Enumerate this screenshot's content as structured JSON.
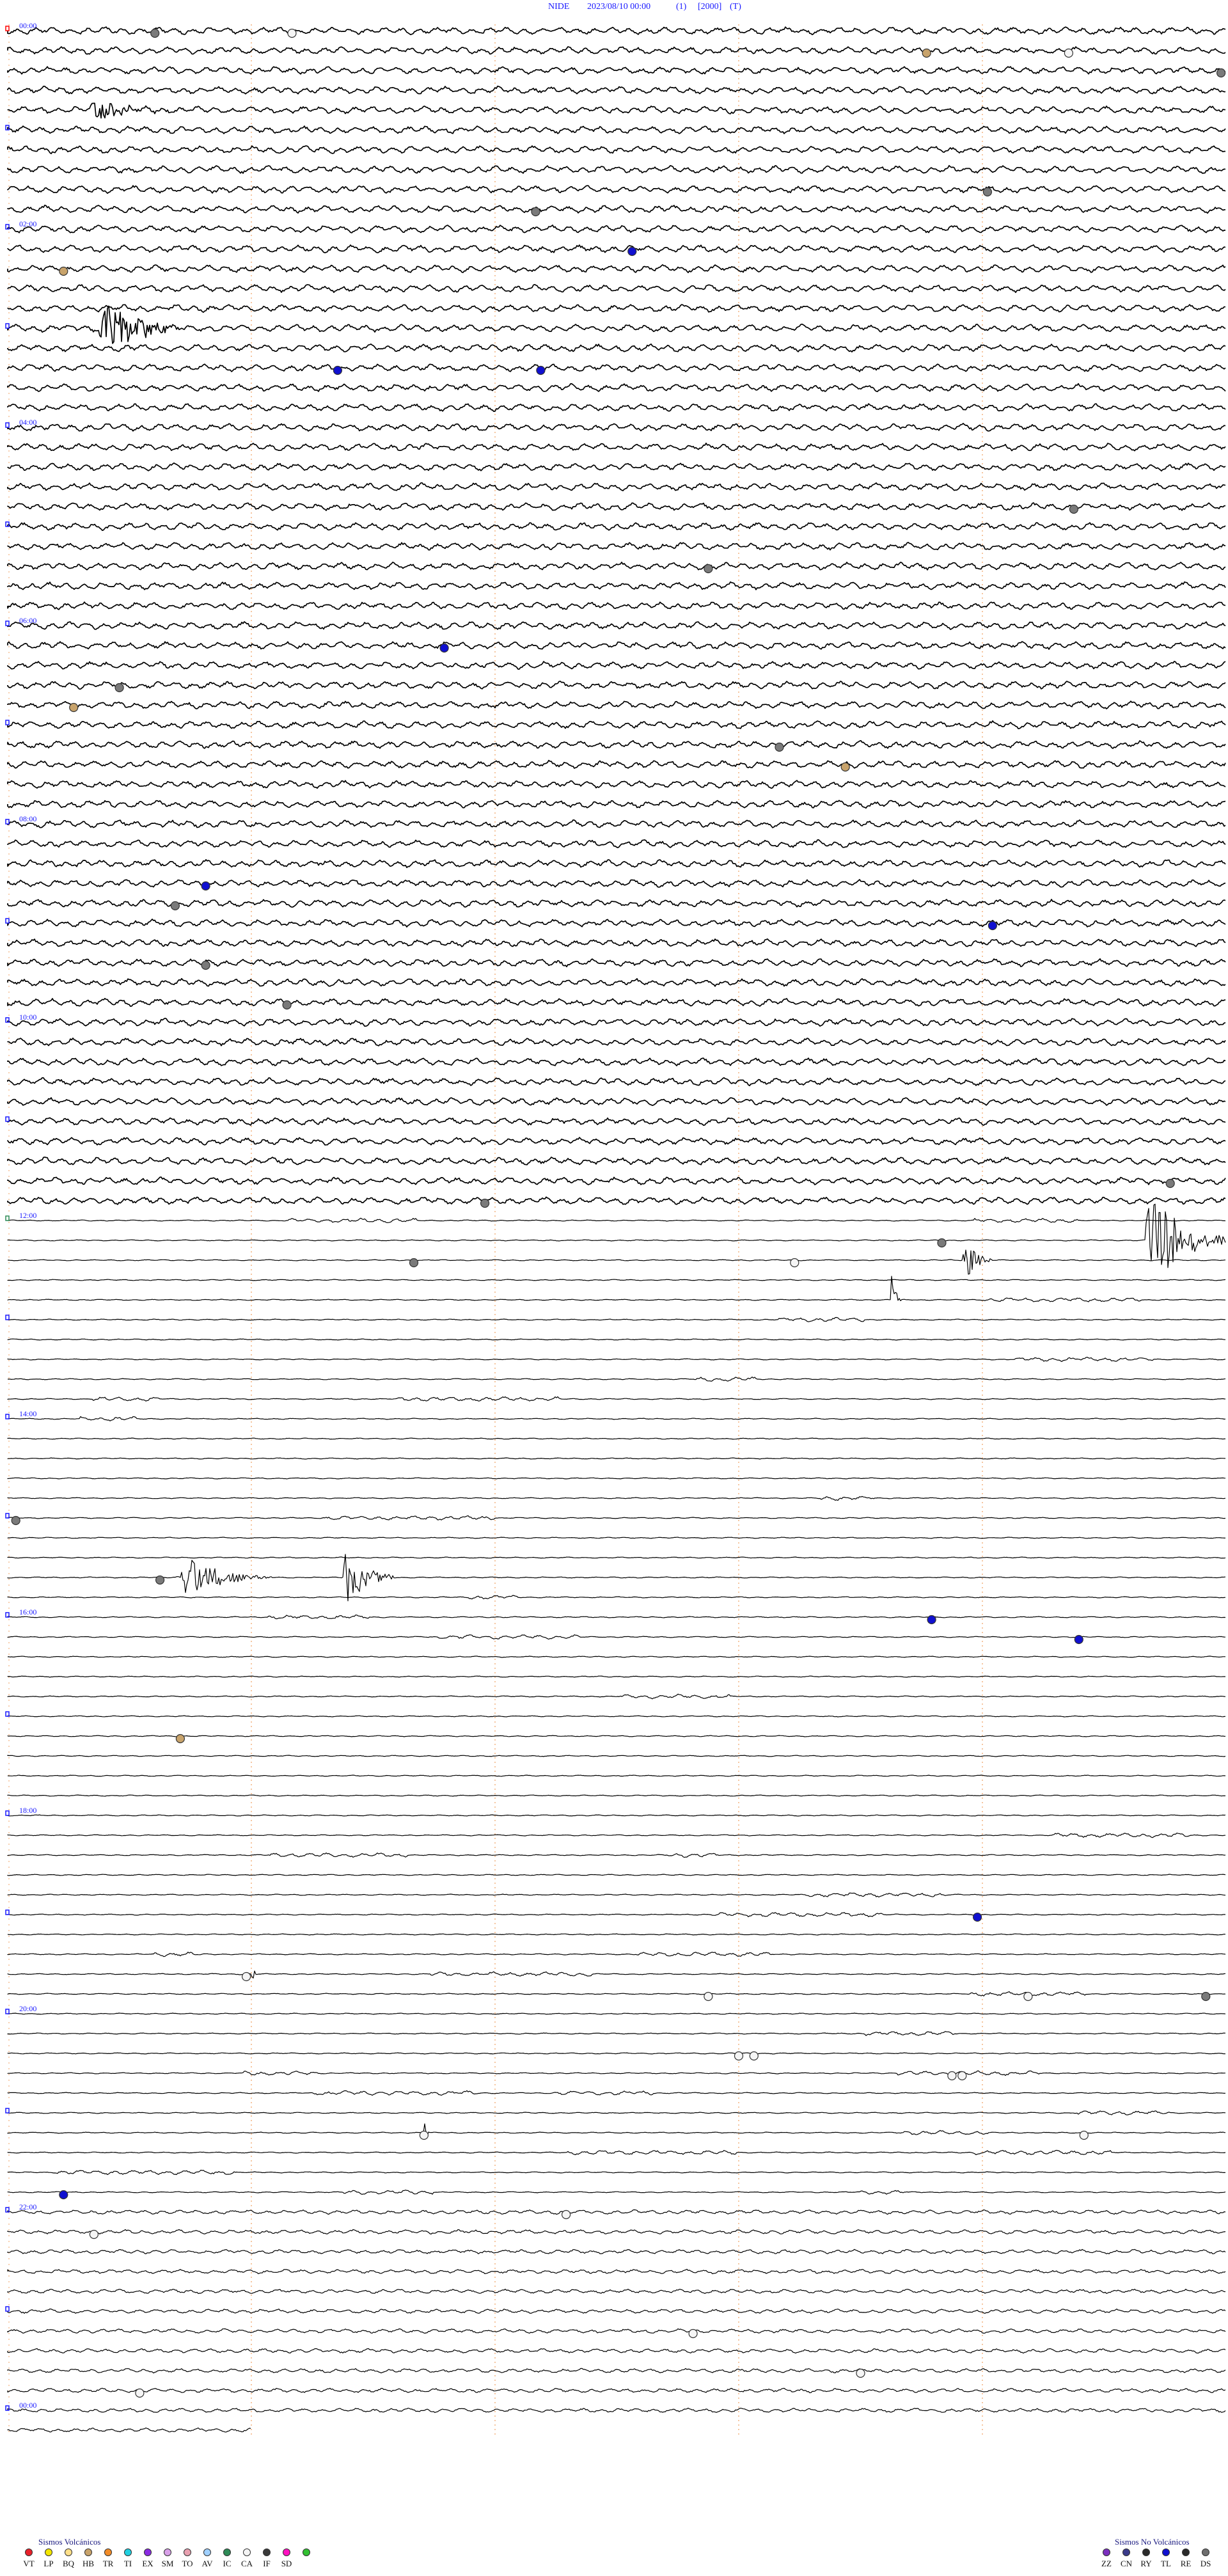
{
  "header": {
    "station": "NIDE",
    "datetime": "2023/08/10 00:00",
    "channel": "(1)",
    "scale": "[2000]",
    "mode": "(T)"
  },
  "chart_data": {
    "type": "line",
    "title": "NIDE 2023/08/10 00:00 (1) [2000] (T)",
    "xlabel": "",
    "ylabel": "",
    "row_count": 122,
    "minutes_per_row": 12,
    "hour_labels": [
      {
        "row": 0,
        "text": "00:00"
      },
      {
        "row": 10,
        "text": "02:00"
      },
      {
        "row": 20,
        "text": "04:00"
      },
      {
        "row": 30,
        "text": "06:00"
      },
      {
        "row": 40,
        "text": "08:00"
      },
      {
        "row": 50,
        "text": "10:00"
      },
      {
        "row": 60,
        "text": "12:00"
      },
      {
        "row": 70,
        "text": "14:00"
      },
      {
        "row": 80,
        "text": "16:00"
      },
      {
        "row": 90,
        "text": "18:00"
      },
      {
        "row": 100,
        "text": "20:00"
      },
      {
        "row": 110,
        "text": "22:00"
      },
      {
        "row": 120,
        "text": "00:00"
      }
    ],
    "minute_gridlines": [
      2.4,
      4.8,
      7.2,
      9.6
    ],
    "segments": [
      {
        "name": "00:00-12:00",
        "from_row": 0,
        "to_row": 60,
        "noise": "high"
      },
      {
        "name": "12:00-22:00",
        "from_row": 60,
        "to_row": 110,
        "noise": "low"
      },
      {
        "name": "22:00-00:00",
        "from_row": 110,
        "to_row": 122,
        "noise": "medium"
      }
    ],
    "bursts": [
      {
        "row": 4,
        "minute": 0.8,
        "duration_min": 0.8,
        "amp": 0.6
      },
      {
        "row": 15,
        "minute": 0.9,
        "duration_min": 0.8,
        "amp": 2.0
      },
      {
        "row": 61,
        "minute": 11.2,
        "duration_min": 0.9,
        "amp": 3.0
      },
      {
        "row": 62,
        "minute": 9.4,
        "duration_min": 0.3,
        "amp": 1.5
      },
      {
        "row": 64,
        "minute": 8.7,
        "duration_min": 0.1,
        "amp": 1.8
      },
      {
        "row": 78,
        "minute": 1.7,
        "duration_min": 0.9,
        "amp": 1.3
      },
      {
        "row": 78,
        "minute": 3.3,
        "duration_min": 0.5,
        "amp": 2.3
      },
      {
        "row": 98,
        "minute": 2.4,
        "duration_min": 0.05,
        "amp": 1.8
      },
      {
        "row": 106,
        "minute": 4.1,
        "duration_min": 0.05,
        "amp": 1.3
      }
    ],
    "events": [
      {
        "row": 0,
        "minute": 1.45,
        "type": "EX"
      },
      {
        "row": 0,
        "minute": 2.8,
        "type": "IC"
      },
      {
        "row": 1,
        "minute": 9.05,
        "type": "HB"
      },
      {
        "row": 1,
        "minute": 10.45,
        "type": "IC"
      },
      {
        "row": 2,
        "minute": 11.95,
        "type": "EX"
      },
      {
        "row": 8,
        "minute": 9.65,
        "type": "EX"
      },
      {
        "row": 9,
        "minute": 5.2,
        "type": "EX"
      },
      {
        "row": 11,
        "minute": 6.15,
        "type": "TL"
      },
      {
        "row": 12,
        "minute": 0.55,
        "type": "HB"
      },
      {
        "row": 17,
        "minute": 3.25,
        "type": "TL"
      },
      {
        "row": 17,
        "minute": 5.25,
        "type": "TL"
      },
      {
        "row": 24,
        "minute": 10.5,
        "type": "EX"
      },
      {
        "row": 27,
        "minute": 6.9,
        "type": "EX"
      },
      {
        "row": 31,
        "minute": 4.3,
        "type": "TL"
      },
      {
        "row": 33,
        "minute": 1.1,
        "type": "EX"
      },
      {
        "row": 34,
        "minute": 0.65,
        "type": "HB"
      },
      {
        "row": 36,
        "minute": 7.6,
        "type": "EX"
      },
      {
        "row": 37,
        "minute": 8.25,
        "type": "HB"
      },
      {
        "row": 43,
        "minute": 1.95,
        "type": "TL"
      },
      {
        "row": 44,
        "minute": 1.65,
        "type": "EX"
      },
      {
        "row": 45,
        "minute": 9.7,
        "type": "TL"
      },
      {
        "row": 47,
        "minute": 1.95,
        "type": "EX"
      },
      {
        "row": 49,
        "minute": 2.75,
        "type": "EX"
      },
      {
        "row": 58,
        "minute": 11.45,
        "type": "EX"
      },
      {
        "row": 59,
        "minute": 4.7,
        "type": "EX"
      },
      {
        "row": 61,
        "minute": 9.2,
        "type": "EX"
      },
      {
        "row": 62,
        "minute": 4.0,
        "type": "EX"
      },
      {
        "row": 62,
        "minute": 7.75,
        "type": "IC"
      },
      {
        "row": 75,
        "minute": 0.08,
        "type": "EX"
      },
      {
        "row": 78,
        "minute": 1.5,
        "type": "EX"
      },
      {
        "row": 80,
        "minute": 9.1,
        "type": "TL"
      },
      {
        "row": 81,
        "minute": 10.55,
        "type": "TL"
      },
      {
        "row": 86,
        "minute": 1.7,
        "type": "HB"
      },
      {
        "row": 95,
        "minute": 9.55,
        "type": "TL"
      },
      {
        "row": 98,
        "minute": 2.35,
        "type": "IC"
      },
      {
        "row": 99,
        "minute": 6.9,
        "type": "IC"
      },
      {
        "row": 99,
        "minute": 10.05,
        "type": "IC"
      },
      {
        "row": 99,
        "minute": 11.8,
        "type": "EX"
      },
      {
        "row": 102,
        "minute": 7.2,
        "type": "IC"
      },
      {
        "row": 102,
        "minute": 7.35,
        "type": "IC"
      },
      {
        "row": 103,
        "minute": 9.3,
        "type": "IC"
      },
      {
        "row": 103,
        "minute": 9.4,
        "type": "IC"
      },
      {
        "row": 106,
        "minute": 4.1,
        "type": "IC"
      },
      {
        "row": 106,
        "minute": 10.6,
        "type": "IC"
      },
      {
        "row": 109,
        "minute": 0.55,
        "type": "TL"
      },
      {
        "row": 110,
        "minute": 5.5,
        "type": "IC"
      },
      {
        "row": 111,
        "minute": 0.85,
        "type": "IC"
      },
      {
        "row": 116,
        "minute": 6.75,
        "type": "IC"
      },
      {
        "row": 118,
        "minute": 8.4,
        "type": "IC"
      },
      {
        "row": 119,
        "minute": 1.3,
        "type": "IC"
      }
    ]
  },
  "legend": {
    "volcanic_title": "Sismos Volcánicos",
    "volcanic": [
      {
        "code": "VT",
        "color": "#e8202a"
      },
      {
        "code": "LP",
        "color": "#f3e600"
      },
      {
        "code": "BQ",
        "color": "#ffe08a"
      },
      {
        "code": "HB",
        "color": "#c8a36b"
      },
      {
        "code": "TR",
        "color": "#f28c28"
      },
      {
        "code": "TI",
        "color": "#20d0e0"
      },
      {
        "code": "EX",
        "color": "#8a2be2"
      },
      {
        "code": "SM",
        "color": "#d8a0e8"
      },
      {
        "code": "TO",
        "color": "#e8a0b0"
      },
      {
        "code": "AV",
        "color": "#a0d0ff"
      },
      {
        "code": "IC",
        "color": "#2e8b57"
      },
      {
        "code": "CA",
        "color": "#f5f5f5"
      },
      {
        "code": "IF",
        "color": "#3a3a3a"
      },
      {
        "code": "SD",
        "color": "#ff10c0"
      },
      {
        "code": "",
        "color": "#32c032"
      }
    ],
    "nonvolcanic_title": "Sismos No Volcánicos",
    "nonvolcanic": [
      {
        "code": "ZZ",
        "color": "#7b2fbe"
      },
      {
        "code": "CN",
        "color": "#3a3a8a"
      },
      {
        "code": "RY",
        "color": "#2a2a2a"
      },
      {
        "code": "TL",
        "color": "#1010d0"
      },
      {
        "code": "RE",
        "color": "#2a2a2a"
      },
      {
        "code": "DS",
        "color": "#6e6e6e"
      }
    ]
  },
  "colors": {
    "trace": "#000000",
    "hour_label": "#1a1aff",
    "minute_grid": "#f0a060",
    "first_marker": "#ff0000",
    "noon_marker": "#2e8b57"
  }
}
